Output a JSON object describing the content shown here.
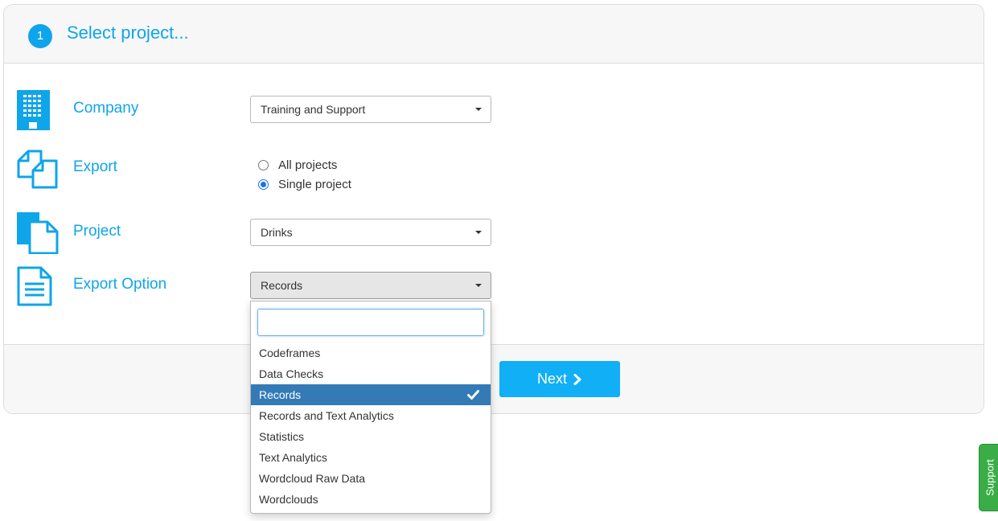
{
  "header": {
    "step_number": "1",
    "title": "Select project..."
  },
  "form": {
    "company": {
      "label": "Company",
      "value": "Training and Support"
    },
    "export": {
      "label": "Export",
      "options": [
        {
          "label": "All projects",
          "checked": false
        },
        {
          "label": "Single project",
          "checked": true
        }
      ]
    },
    "project": {
      "label": "Project",
      "value": "Drinks"
    },
    "export_option": {
      "label": "Export Option",
      "value": "Records"
    }
  },
  "dropdown": {
    "search_value": "",
    "items": [
      {
        "label": "Codeframes"
      },
      {
        "label": "Data Checks"
      },
      {
        "label": "Records",
        "selected": true
      },
      {
        "label": "Records and Text Analytics"
      },
      {
        "label": "Statistics"
      },
      {
        "label": "Text Analytics"
      },
      {
        "label": "Wordcloud Raw Data"
      },
      {
        "label": "Wordclouds"
      }
    ]
  },
  "footer": {
    "next_label": "Next"
  },
  "support_tab": {
    "label": "Support"
  },
  "colors": {
    "accent": "#0fa5ea",
    "button": "#11aff6",
    "selected_item": "#337ab7",
    "support": "#3aad47"
  },
  "icons": [
    "building-icon",
    "copy-documents-icon",
    "project-documents-icon",
    "document-lines-icon",
    "chevron-right-icon",
    "checkmark-icon"
  ]
}
